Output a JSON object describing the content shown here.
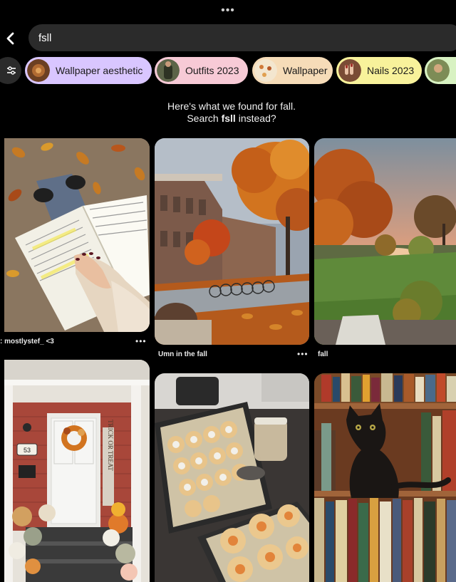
{
  "handle": "•••",
  "search": {
    "value": "fsll",
    "back_label": "<"
  },
  "chips": [
    {
      "label": "Wallpaper aesthetic",
      "bg": "#d9c6ff",
      "thumb": "#7a4a2a"
    },
    {
      "label": "Outfits 2023",
      "bg": "#f7cad6",
      "thumb": "#4d5a3a"
    },
    {
      "label": "Wallpaper",
      "bg": "#f6dcb8",
      "thumb": "#e8d3b0"
    },
    {
      "label": "Nails 2023",
      "bg": "#f8f29b",
      "thumb": "#8a5a3a"
    },
    {
      "label": "",
      "bg": "#d8f2c2",
      "thumb": "#6a8a4a"
    }
  ],
  "notice": {
    "line1": "Here's what we found for fall.",
    "prefix": "Search ",
    "term": "fsll",
    "suffix": " instead?"
  },
  "pins": [
    {
      "caption": ": mostlystef_ <3",
      "more": "•••"
    },
    {
      "caption": "Umn in the fall",
      "more": "•••"
    },
    {
      "caption": "fall",
      "more": ""
    }
  ],
  "porch_sign": "TRICK OR TREAT",
  "house_number": "53"
}
